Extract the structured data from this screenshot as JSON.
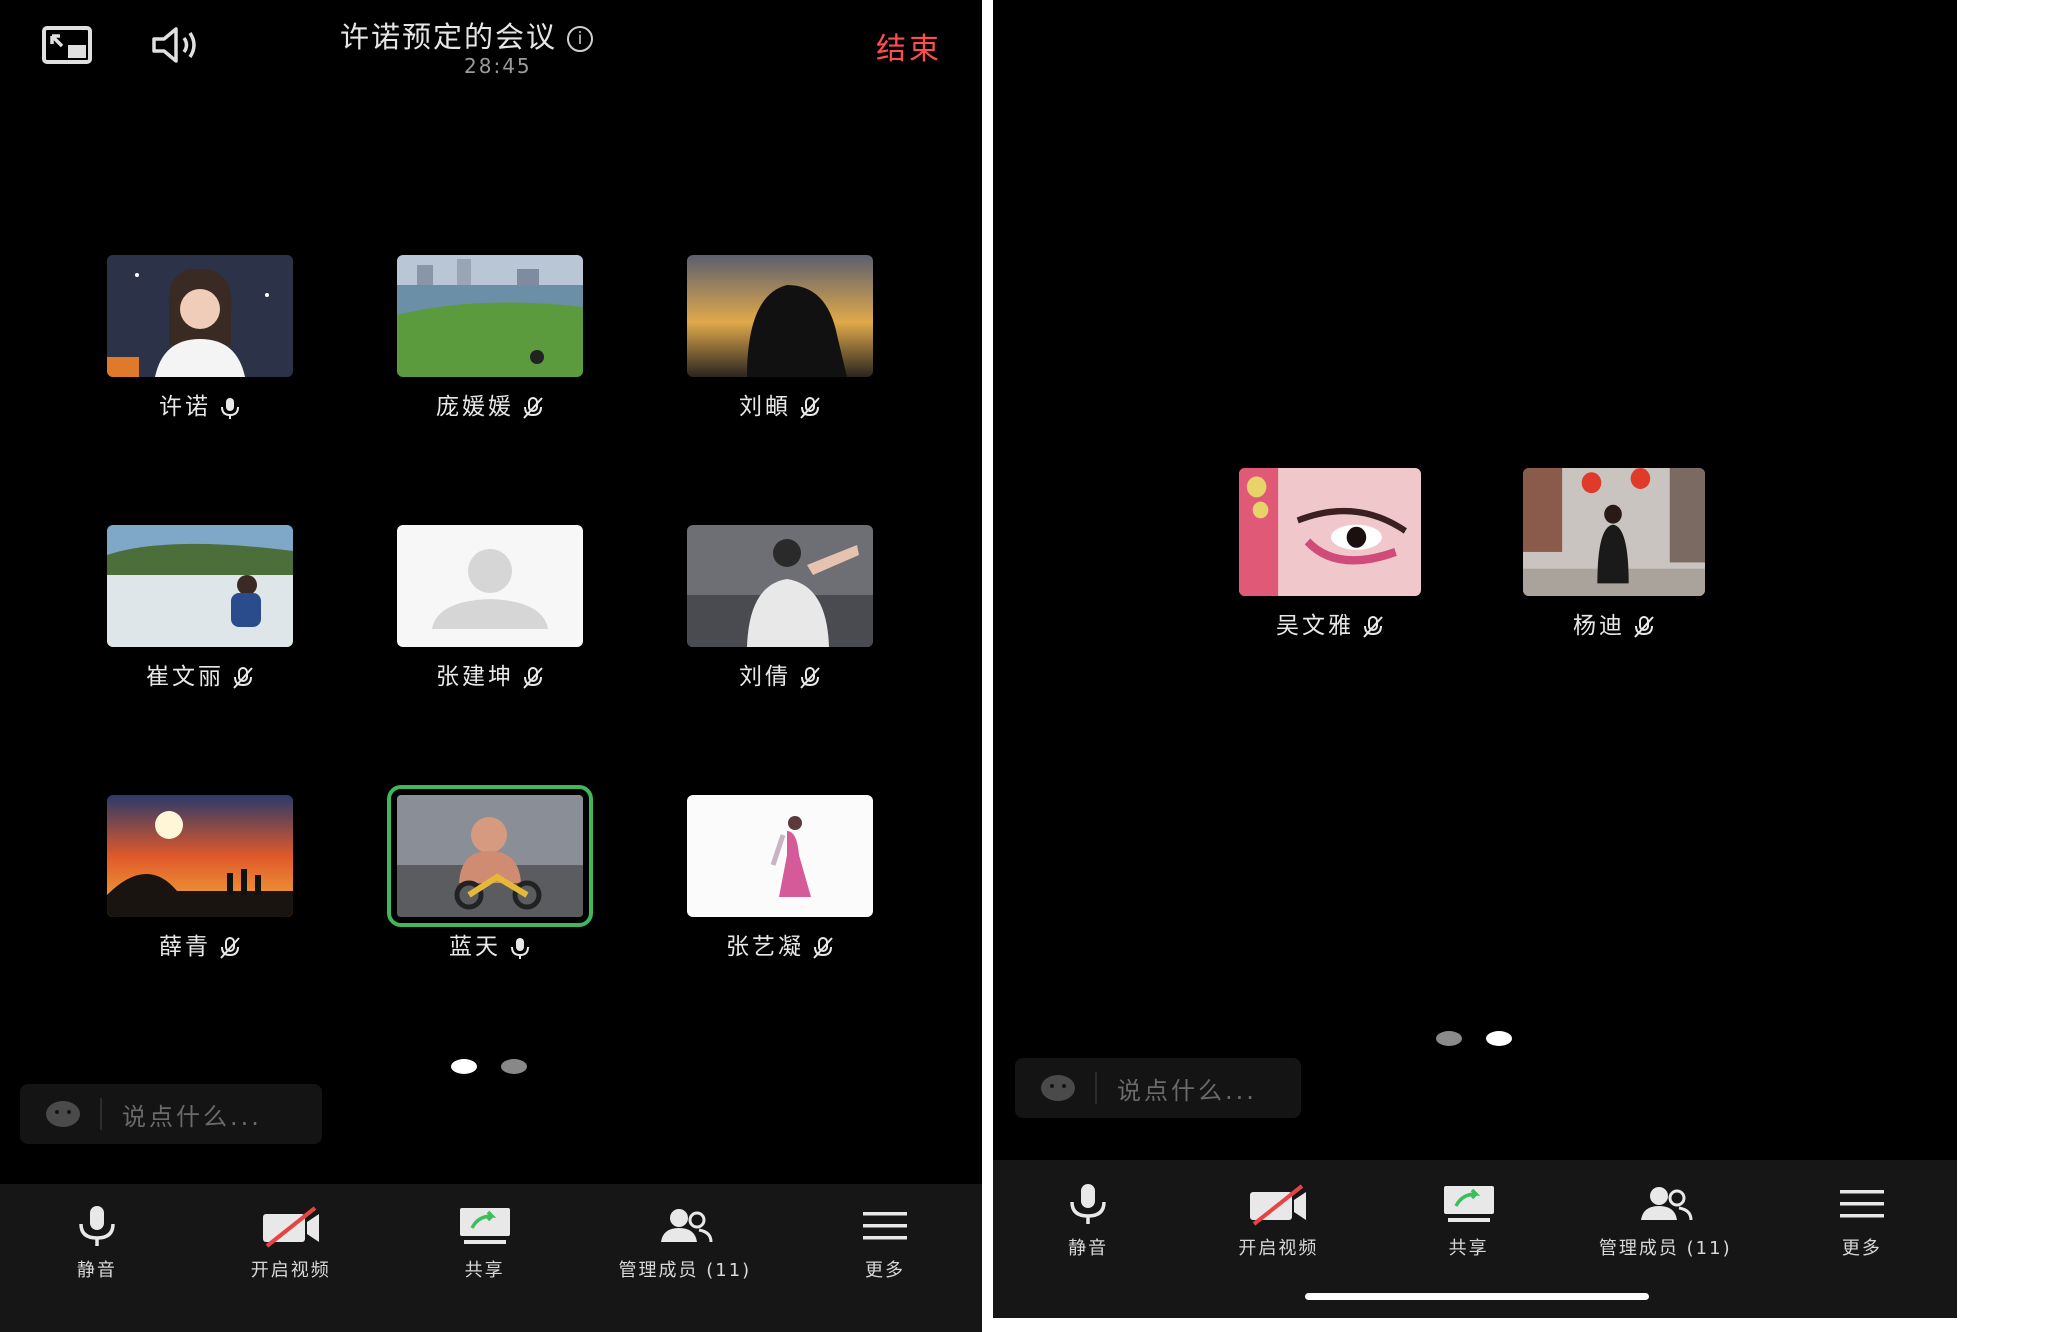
{
  "screen1": {
    "title": "许诺预定的会议",
    "timer": "28:45",
    "end_label": "结束",
    "participants": [
      {
        "name": "许诺",
        "mic": "on"
      },
      {
        "name": "庞媛媛",
        "mic": "muted"
      },
      {
        "name": "刘頔",
        "mic": "muted"
      },
      {
        "name": "崔文丽",
        "mic": "muted"
      },
      {
        "name": "张建坤",
        "mic": "muted"
      },
      {
        "name": "刘倩",
        "mic": "muted"
      },
      {
        "name": "薛青",
        "mic": "muted"
      },
      {
        "name": "蓝天",
        "mic": "on",
        "speaking": true
      },
      {
        "name": "张艺凝",
        "mic": "muted"
      }
    ],
    "pages": {
      "count": 2,
      "current": 1
    },
    "chat_placeholder": "说点什么...",
    "toolbar": [
      {
        "label": "静音",
        "icon": "microphone-icon"
      },
      {
        "label": "开启视频",
        "icon": "video-off-icon"
      },
      {
        "label": "共享",
        "icon": "share-screen-icon"
      },
      {
        "label": "管理成员 (11)",
        "icon": "members-icon"
      },
      {
        "label": "更多",
        "icon": "menu-icon"
      }
    ]
  },
  "screen2": {
    "participants": [
      {
        "name": "吴文雅",
        "mic": "muted"
      },
      {
        "name": "杨迪",
        "mic": "muted"
      }
    ],
    "pages": {
      "count": 2,
      "current": 2
    },
    "chat_placeholder": "说点什么...",
    "toolbar": [
      {
        "label": "静音",
        "icon": "microphone-icon"
      },
      {
        "label": "开启视频",
        "icon": "video-off-icon"
      },
      {
        "label": "共享",
        "icon": "share-screen-icon"
      },
      {
        "label": "管理成员 (11)",
        "icon": "members-icon"
      },
      {
        "label": "更多",
        "icon": "menu-icon"
      }
    ]
  },
  "colors": {
    "background": "#000000",
    "end_button": "#ff4d4d",
    "speaking_border": "#41b75a",
    "toolbar_bg": "#161616"
  }
}
